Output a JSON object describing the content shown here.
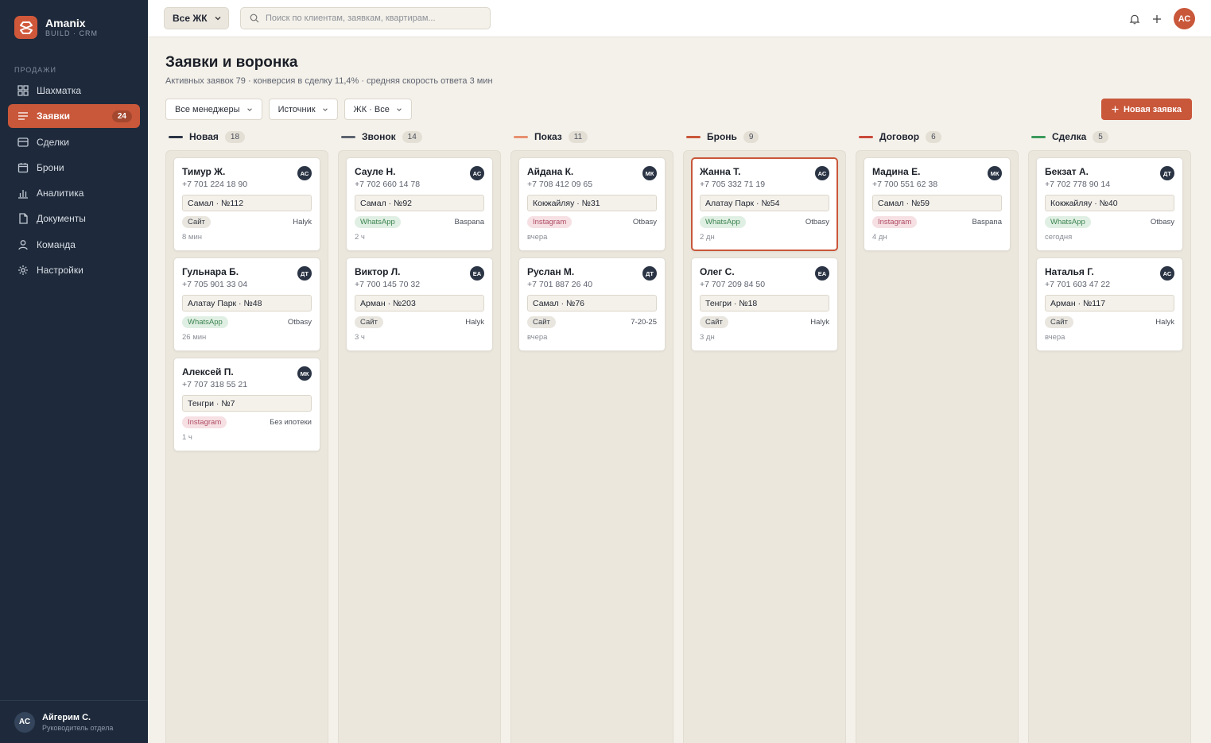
{
  "brand": {
    "name": "Amanix",
    "sub": "BUILD · CRM"
  },
  "sidebar": {
    "section": "ПРОДАЖИ",
    "items": [
      {
        "label": "Шахматка",
        "icon": "grid-icon"
      },
      {
        "label": "Заявки",
        "icon": "list-icon",
        "badge": "24",
        "active": true
      },
      {
        "label": "Сделки",
        "icon": "inbox-icon"
      },
      {
        "label": "Брони",
        "icon": "calendar-icon"
      },
      {
        "label": "Аналитика",
        "icon": "bar-chart-icon"
      },
      {
        "label": "Документы",
        "icon": "document-icon"
      },
      {
        "label": "Команда",
        "icon": "user-icon"
      },
      {
        "label": "Настройки",
        "icon": "gear-icon"
      }
    ],
    "user": {
      "initials": "АС",
      "name": "Айгерим С.",
      "role": "Руководитель отдела"
    }
  },
  "topbar": {
    "complex_select": "Все ЖК",
    "search_placeholder": "Поиск по клиентам, заявкам, квартирам...",
    "avatar": "АС"
  },
  "header": {
    "title": "Заявки и воронка",
    "subtitle": "Активных заявок 79 · конверсия в сделку 11,4% · средняя скорость ответа 3 мин"
  },
  "filters": [
    "Все менеджеры",
    "Источник",
    "ЖК · Все"
  ],
  "new_button": "Новая заявка",
  "colors": {
    "accent": "#c9573a",
    "sidebar": "#1e2a3b"
  },
  "columns": [
    {
      "title": "Новая",
      "count": "18",
      "color": "#2a3444",
      "cards": [
        {
          "name": "Тимур Ж.",
          "phone": "+7 701 224 18 90",
          "avatar": "АС",
          "unit": "Самал · №112",
          "source": "Сайт",
          "src": "site",
          "bank": "Halyk",
          "time": "8 мин"
        },
        {
          "name": "Гульнара Б.",
          "phone": "+7 705 901 33 04",
          "avatar": "ДТ",
          "unit": "Алатау Парк · №48",
          "source": "WhatsApp",
          "src": "wa",
          "bank": "Otbasy",
          "time": "26 мин"
        },
        {
          "name": "Алексей П.",
          "phone": "+7 707 318 55 21",
          "avatar": "МК",
          "unit": "Тенгри · №7",
          "source": "Instagram",
          "src": "ig",
          "bank": "Без ипотеки",
          "time": "1 ч"
        }
      ]
    },
    {
      "title": "Звонок",
      "count": "14",
      "color": "#5c6370",
      "cards": [
        {
          "name": "Сауле Н.",
          "phone": "+7 702 660 14 78",
          "avatar": "АС",
          "unit": "Самал · №92",
          "source": "WhatsApp",
          "src": "wa",
          "bank": "Baspana",
          "time": "2 ч"
        },
        {
          "name": "Виктор Л.",
          "phone": "+7 700 145 70 32",
          "avatar": "ЕА",
          "unit": "Арман · №203",
          "source": "Сайт",
          "src": "site",
          "bank": "Halyk",
          "time": "3 ч"
        }
      ]
    },
    {
      "title": "Показ",
      "count": "11",
      "color": "#e8906f",
      "cards": [
        {
          "name": "Айдана К.",
          "phone": "+7 708 412 09 65",
          "avatar": "МК",
          "unit": "Кокжайляу · №31",
          "source": "Instagram",
          "src": "ig",
          "bank": "Otbasy",
          "time": "вчера"
        },
        {
          "name": "Руслан М.",
          "phone": "+7 701 887 26 40",
          "avatar": "ДТ",
          "unit": "Самал · №76",
          "source": "Сайт",
          "src": "site",
          "bank": "7-20-25",
          "time": "вчера"
        }
      ]
    },
    {
      "title": "Бронь",
      "count": "9",
      "color": "#c9573a",
      "cards": [
        {
          "name": "Жанна Т.",
          "phone": "+7 705 332 71 19",
          "avatar": "АС",
          "unit": "Алатау Парк · №54",
          "source": "WhatsApp",
          "src": "wa",
          "bank": "Otbasy",
          "time": "2 дн",
          "selected": true
        },
        {
          "name": "Олег С.",
          "phone": "+7 707 209 84 50",
          "avatar": "ЕА",
          "unit": "Тенгри · №18",
          "source": "Сайт",
          "src": "site",
          "bank": "Halyk",
          "time": "3 дн"
        }
      ]
    },
    {
      "title": "Договор",
      "count": "6",
      "color": "#c94a3a",
      "cards": [
        {
          "name": "Мадина Е.",
          "phone": "+7 700 551 62 38",
          "avatar": "МК",
          "unit": "Самал · №59",
          "source": "Instagram",
          "src": "ig",
          "bank": "Baspana",
          "time": "4 дн"
        }
      ]
    },
    {
      "title": "Сделка",
      "count": "5",
      "color": "#3c9a5c",
      "cards": [
        {
          "name": "Бекзат А.",
          "phone": "+7 702 778 90 14",
          "avatar": "ДТ",
          "unit": "Кокжайляу · №40",
          "source": "WhatsApp",
          "src": "wa",
          "bank": "Otbasy",
          "time": "сегодня"
        },
        {
          "name": "Наталья Г.",
          "phone": "+7 701 603 47 22",
          "avatar": "АС",
          "unit": "Арман · №117",
          "source": "Сайт",
          "src": "site",
          "bank": "Halyk",
          "time": "вчера"
        }
      ]
    }
  ]
}
